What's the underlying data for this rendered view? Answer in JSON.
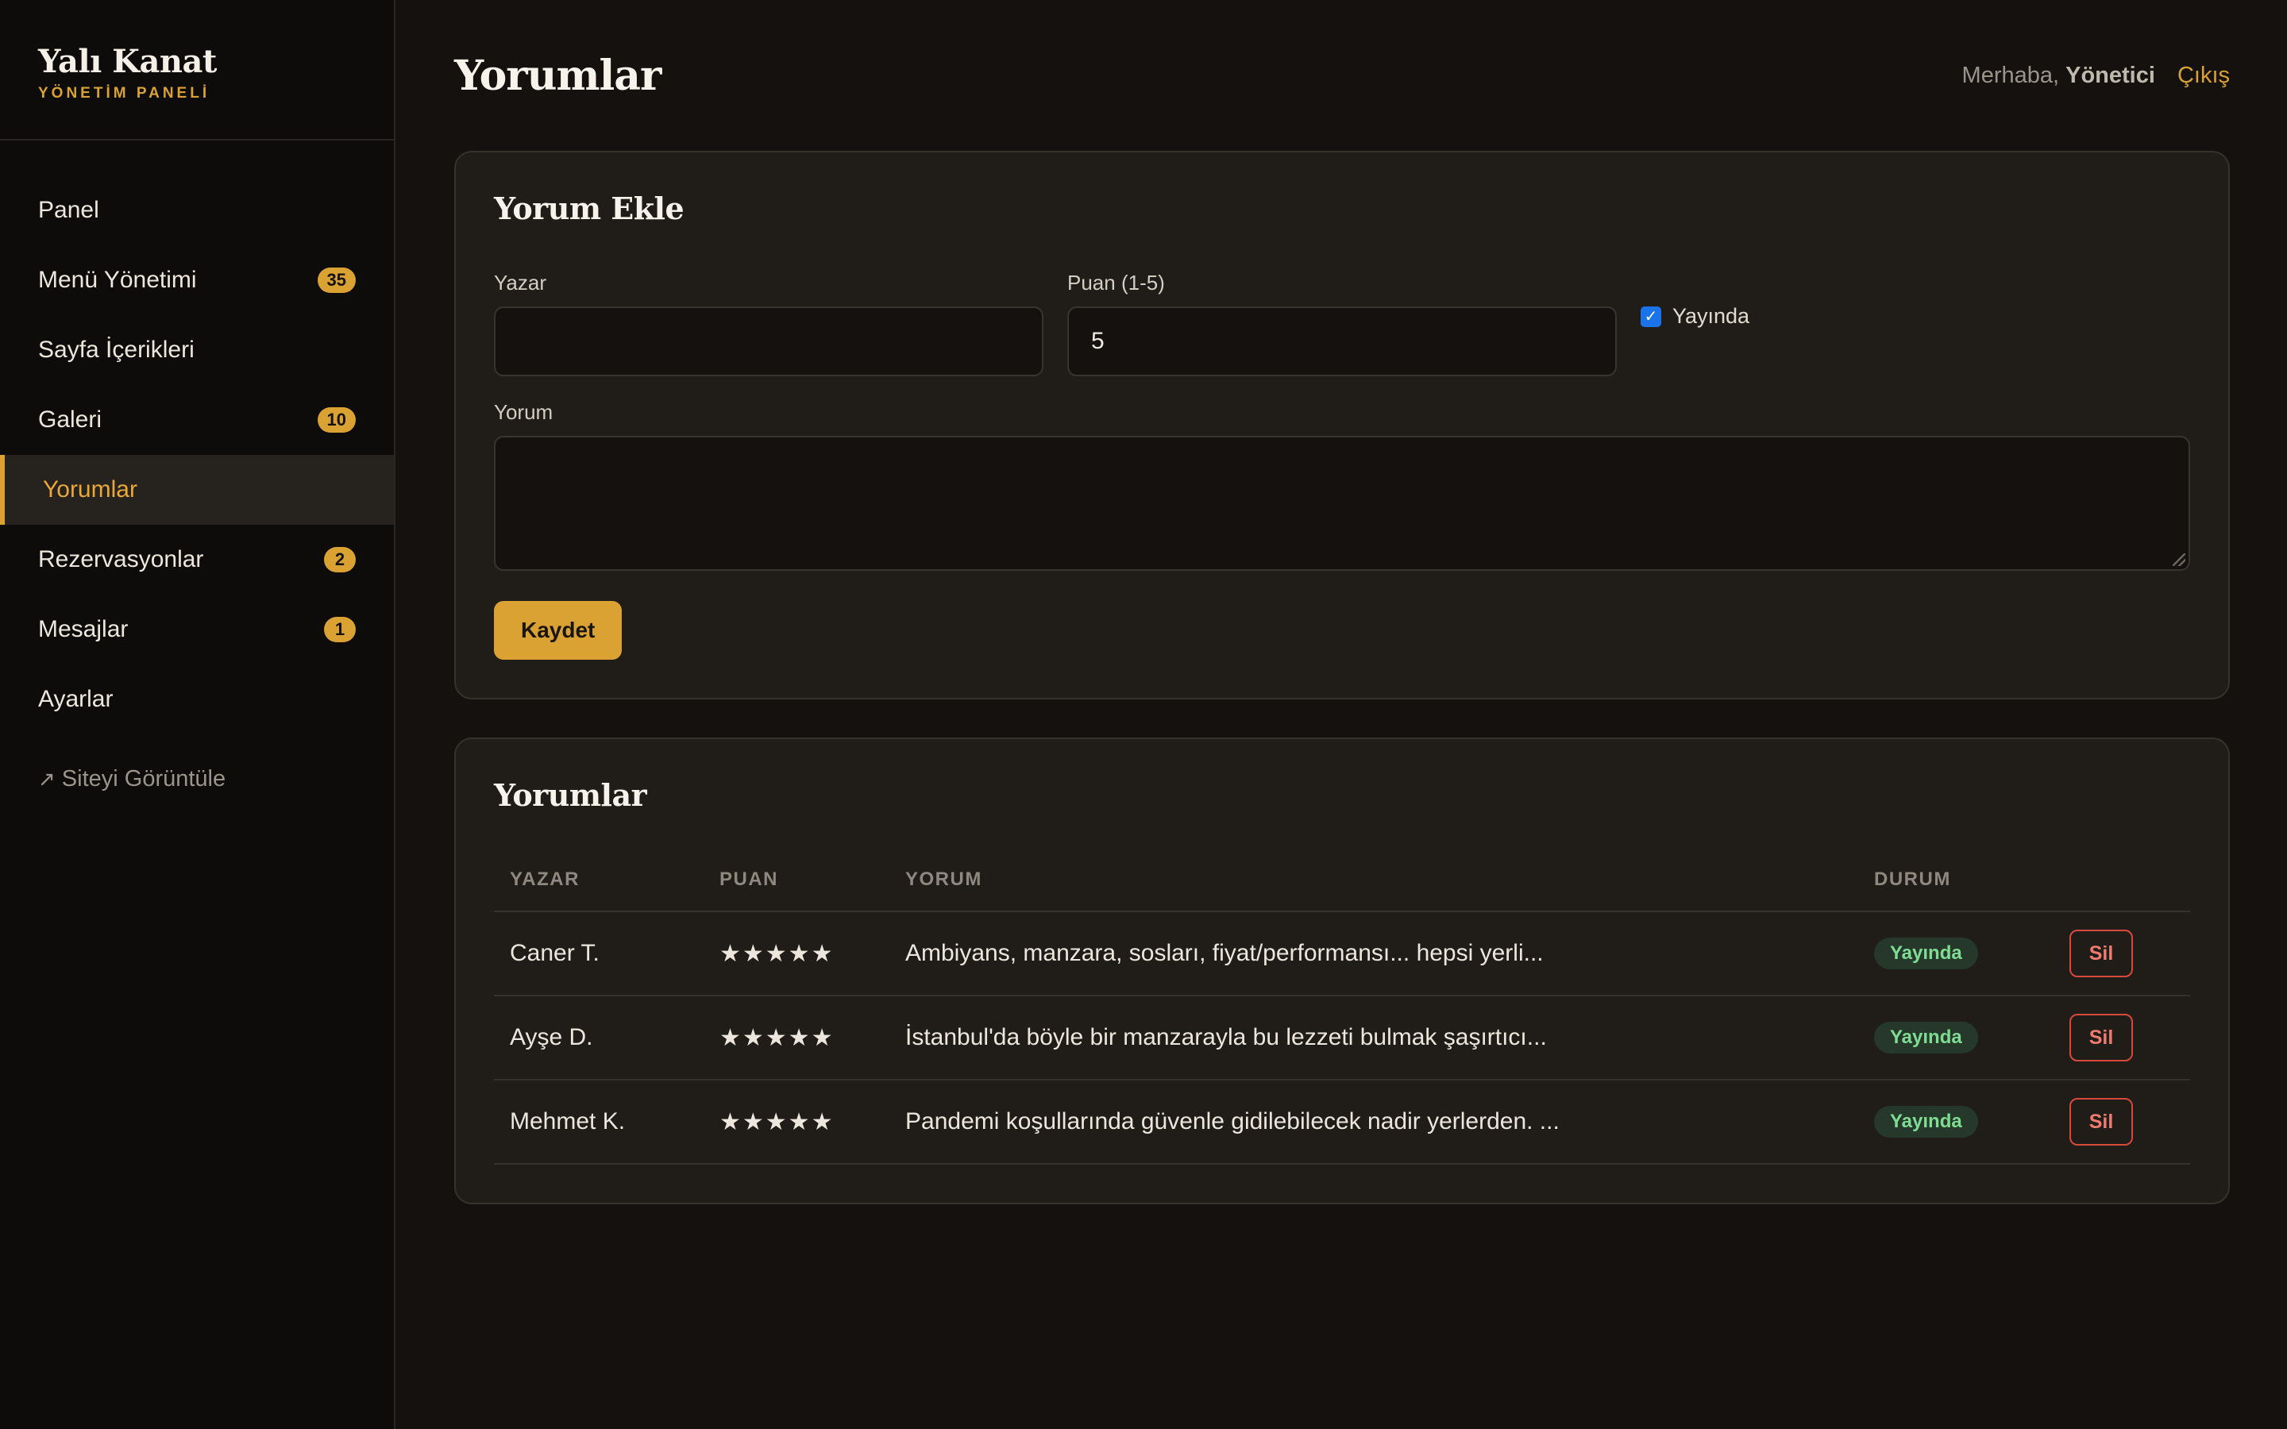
{
  "brand": {
    "title": "Yalı Kanat",
    "subtitle": "YÖNETİM PANELİ"
  },
  "sidebar": {
    "items": [
      {
        "label": "Panel",
        "badge": null
      },
      {
        "label": "Menü Yönetimi",
        "badge": "35"
      },
      {
        "label": "Sayfa İçerikleri",
        "badge": null
      },
      {
        "label": "Galeri",
        "badge": "10"
      },
      {
        "label": "Yorumlar",
        "badge": null,
        "active": true
      },
      {
        "label": "Rezervasyonlar",
        "badge": "2"
      },
      {
        "label": "Mesajlar",
        "badge": "1"
      },
      {
        "label": "Ayarlar",
        "badge": null
      }
    ],
    "view_site": {
      "icon": "↗",
      "label": "Siteyi Görüntüle"
    }
  },
  "header": {
    "title": "Yorumlar",
    "greeting_prefix": "Merhaba,",
    "user_name": "Yönetici",
    "logout": "Çıkış"
  },
  "form": {
    "title": "Yorum Ekle",
    "author_label": "Yazar",
    "author_value": "",
    "rating_label": "Puan (1-5)",
    "rating_value": "5",
    "published_label": "Yayında",
    "published_checked": true,
    "comment_label": "Yorum",
    "comment_value": "",
    "save_label": "Kaydet"
  },
  "reviews": {
    "title": "Yorumlar",
    "columns": {
      "author": "YAZAR",
      "rating": "PUAN",
      "comment": "YORUM",
      "status": "DURUM"
    },
    "rows": [
      {
        "author": "Caner T.",
        "stars": "★★★★★",
        "comment": "Ambiyans, manzara, sosları, fiyat/performansı... hepsi yerli...",
        "status": "Yayında",
        "delete": "Sil"
      },
      {
        "author": "Ayşe D.",
        "stars": "★★★★★",
        "comment": "İstanbul'da böyle bir manzarayla bu lezzeti bulmak şaşırtıcı...",
        "status": "Yayında",
        "delete": "Sil"
      },
      {
        "author": "Mehmet K.",
        "stars": "★★★★★",
        "comment": "Pandemi koşullarında güvenle gidilebilecek nadir yerlerden. ...",
        "status": "Yayında",
        "delete": "Sil"
      }
    ]
  },
  "colors": {
    "accent": "#d9a233",
    "background": "#14110f",
    "card": "#201d19",
    "status_green": "#7fdc93",
    "danger": "#d9483c"
  }
}
